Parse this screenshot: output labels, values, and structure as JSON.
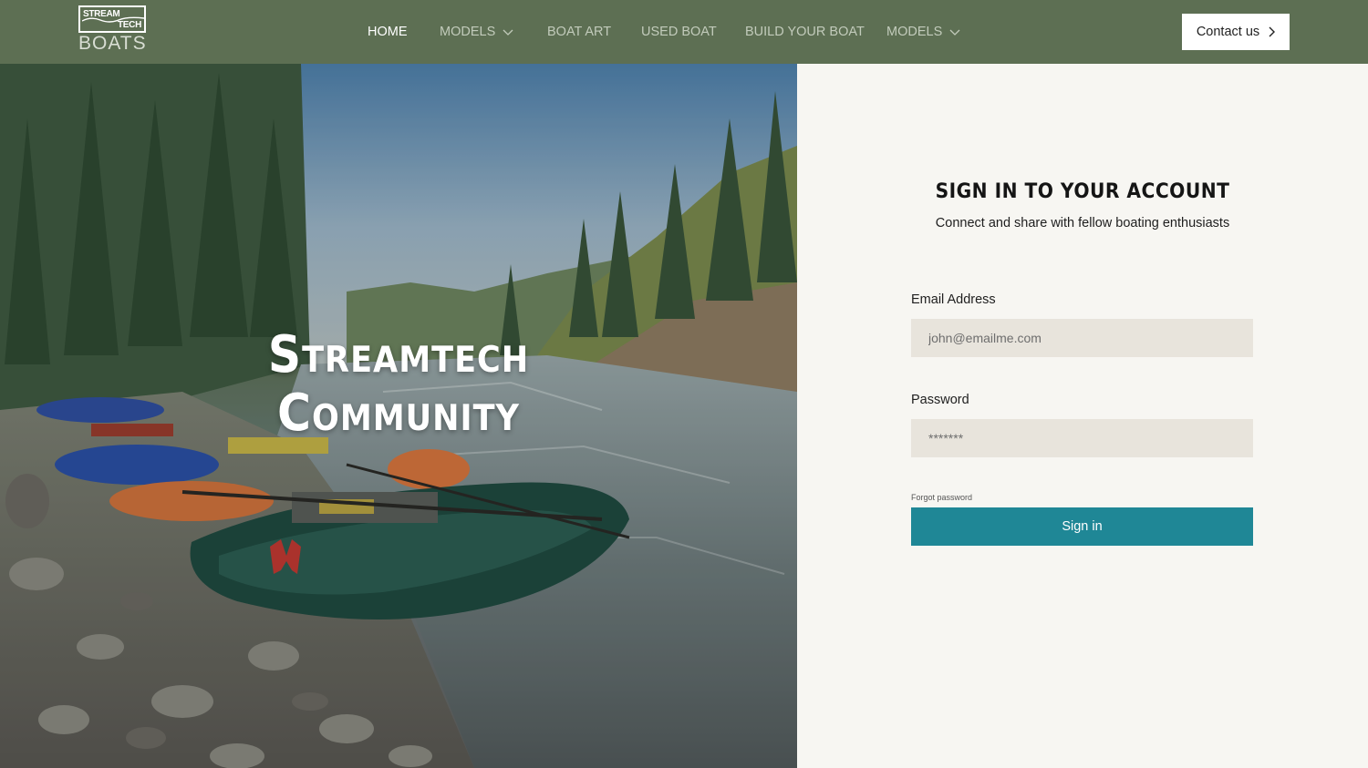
{
  "logo": {
    "line1": "STREAM",
    "line2": "TECH",
    "line3": "BOATS"
  },
  "nav": {
    "items": [
      {
        "label": "HOME",
        "active": true,
        "dropdown": false
      },
      {
        "label": "MODELS",
        "active": false,
        "dropdown": true
      },
      {
        "label": "BOAT ART",
        "active": false,
        "dropdown": false
      },
      {
        "label": "USED BOAT",
        "active": false,
        "dropdown": false
      },
      {
        "label": "BUILD YOUR BOAT",
        "active": false,
        "dropdown": false
      },
      {
        "label": "MODELS",
        "active": false,
        "dropdown": true
      }
    ],
    "contact_label": "Contact us"
  },
  "hero": {
    "title_line1": "Streamtech",
    "title_line2": "Community"
  },
  "signin": {
    "title": "SIGN IN TO YOUR ACCOUNT",
    "subtitle": "Connect and share with fellow boating enthusiasts",
    "email_label": "Email Address",
    "email_placeholder": "john@emailme.com",
    "password_label": "Password",
    "password_placeholder": "*******",
    "forgot_label": "Forgot password",
    "button_label": "Sign in"
  },
  "colors": {
    "header_bg": "#5d6f53",
    "panel_bg": "#f7f6f2",
    "input_bg": "#e8e4dc",
    "button_bg": "#1f8796"
  }
}
